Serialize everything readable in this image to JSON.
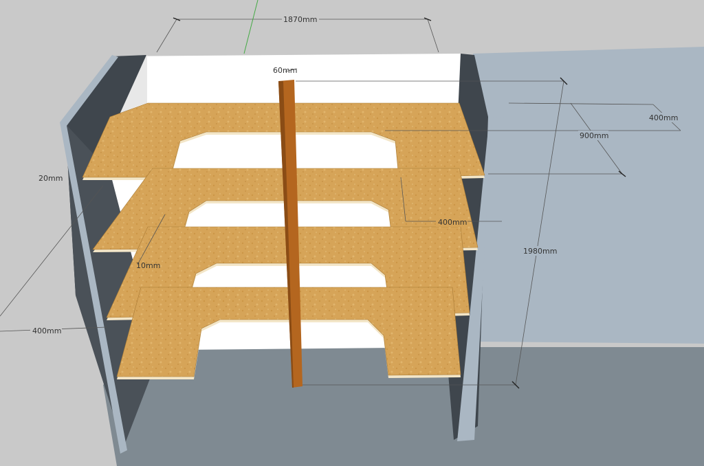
{
  "dimensions": {
    "overall_width": "1870mm",
    "post_width": "60mm",
    "depth_right": "400mm",
    "right_offset": "900mm",
    "height": "1980mm",
    "shelf_thickness": "20mm",
    "notch_depth": "400mm",
    "inner_gap": "10mm",
    "left_depth": "400mm"
  },
  "colors": {
    "background": "#c9c9c9",
    "floor": "#7f8a92",
    "side_panel": "#aab7c3",
    "shadow_panel": "#3f464d",
    "back_wall": "#ffffff",
    "shelf_surface": "#d6a458",
    "shelf_edge": "#f3e6c8",
    "post": "#b4661f",
    "axis_green": "#44aa44"
  }
}
